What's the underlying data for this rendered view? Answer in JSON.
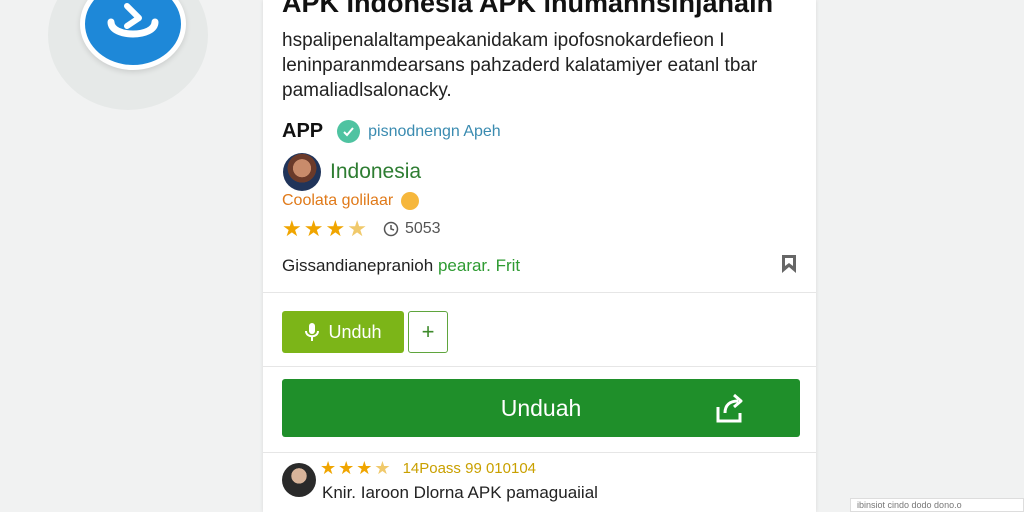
{
  "app": {
    "title": "APK Indonesia  APK inumahnsinjahain",
    "description": "hspalipenalaltampeakanidakam ipofosnokardefieon I leninparanmdearsans pahzaderd kalatamiyer eatanl tbar pamaliadlsalonacky."
  },
  "meta": {
    "app_label": "APP",
    "developer": "pisnodnengn Apeh",
    "country": "Indonesia",
    "subtitle": "Coolata golilaar",
    "rating_stars": 3.5,
    "count": "5053",
    "tagline_prefix": "Gissandianepranioh",
    "tagline_suffix": "pearar. Frit"
  },
  "buttons": {
    "small_download": "Unduh",
    "plus": "+",
    "big_download": "Unduah"
  },
  "review": {
    "stars": 3.5,
    "meta": "14Poass 99 010104",
    "text": "Knir. Iaroon Dlorna APK pamaguaiial"
  },
  "corner_note": "ibinsiot cindo dodo dono.o"
}
